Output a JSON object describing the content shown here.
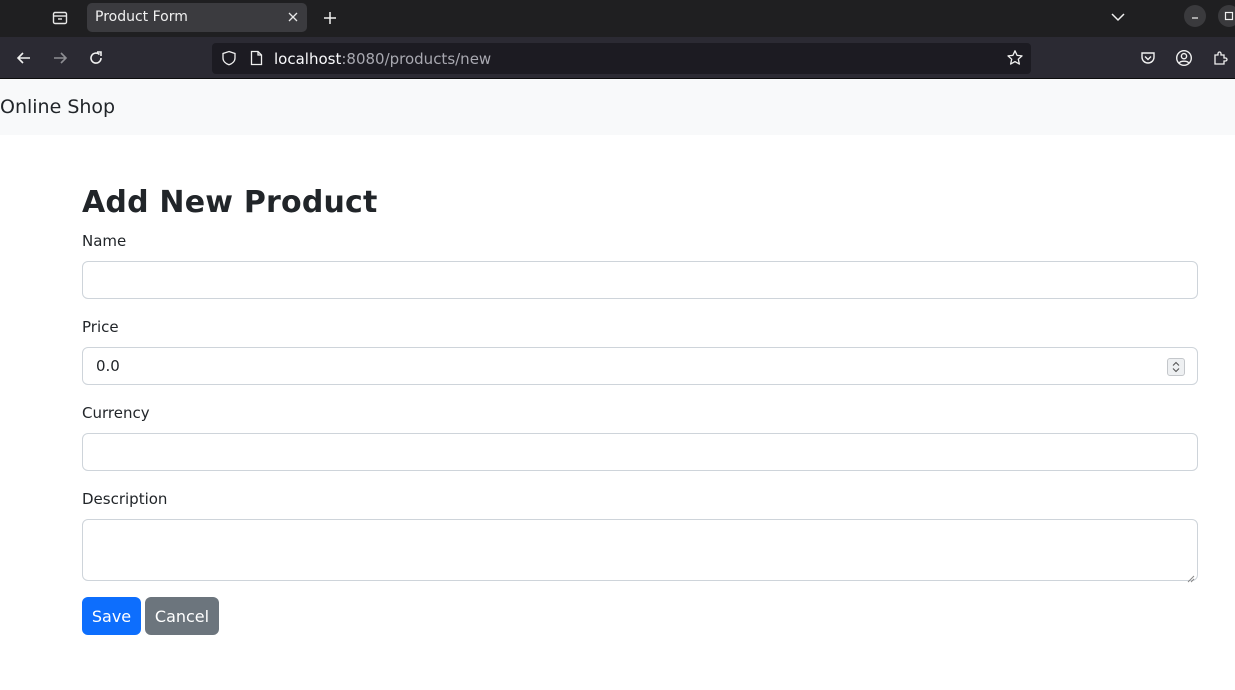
{
  "browser": {
    "tab_title": "Product Form",
    "url_host": "localhost",
    "url_rest": ":8080/products/new"
  },
  "site": {
    "brand": "Online Shop"
  },
  "form": {
    "title": "Add New Product",
    "name_label": "Name",
    "name_value": "",
    "price_label": "Price",
    "price_value": "0.0",
    "currency_label": "Currency",
    "currency_value": "",
    "description_label": "Description",
    "description_value": "",
    "save_label": "Save",
    "cancel_label": "Cancel"
  },
  "colors": {
    "primary": "#0d6efd",
    "secondary": "#6c757d",
    "navbar_bg": "#f8f9fa"
  },
  "icons": [
    "tab-list-icon",
    "close-icon",
    "plus-icon",
    "chevron-down-icon",
    "minimize-icon",
    "maximize-icon",
    "back-icon",
    "forward-icon",
    "reload-icon",
    "shield-icon",
    "page-icon",
    "star-icon",
    "pocket-icon",
    "account-icon",
    "extensions-icon"
  ]
}
